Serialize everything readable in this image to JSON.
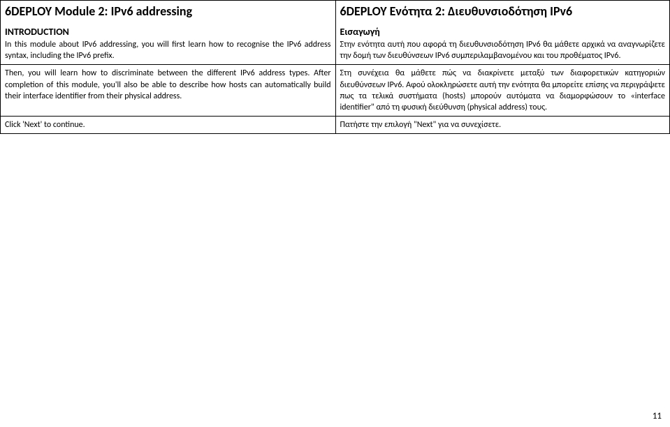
{
  "left": {
    "title": "6DEPLOY Module 2:  IPv6 addressing",
    "subtitle": "INTRODUCTION",
    "intro": "In this module about IPv6 addressing, you will first learn how to recognise the IPv6 address syntax, including the IPv6 prefix.",
    "para1": "Then, you will learn how to discriminate between the different IPv6 address types. After completion of this module, you'll also be able to describe how hosts can automatically build their interface identifier from their physical address.",
    "click_next": "Click 'Next' to continue."
  },
  "right": {
    "title": "6DEPLOY Ενότητα 2:  Διευθυνσιοδότηση IPv6",
    "subtitle": "Εισαγωγή",
    "intro": "Στην ενότητα αυτή που αφορά τη διευθυνσιοδότηση IPv6 θα μάθετε αρχικά να αναγνωρίζετε την δομή των διευθύνσεων IPv6 συμπεριλαμβανομένου και του προθέματος IPv6.",
    "para1": "Στη συνέχεια θα μάθετε πώς να διακρίνετε μεταξύ των διαφορετικών κατηγοριών διευθύνσεων IPv6. Αφού ολοκληρώσετε αυτή την ενότητα θα μπορείτε επίσης να περιγράψετε πως τα τελικά συστήματα (hosts) μπορούν αυτόματα να διαμορφώσουν το «interface identifier\" από τη φυσική διεύθυνση (physical address) τους.",
    "click_next": "Πατήστε την επιλογή \"Next\" για να συνεχίσετε."
  },
  "page_number": "11"
}
